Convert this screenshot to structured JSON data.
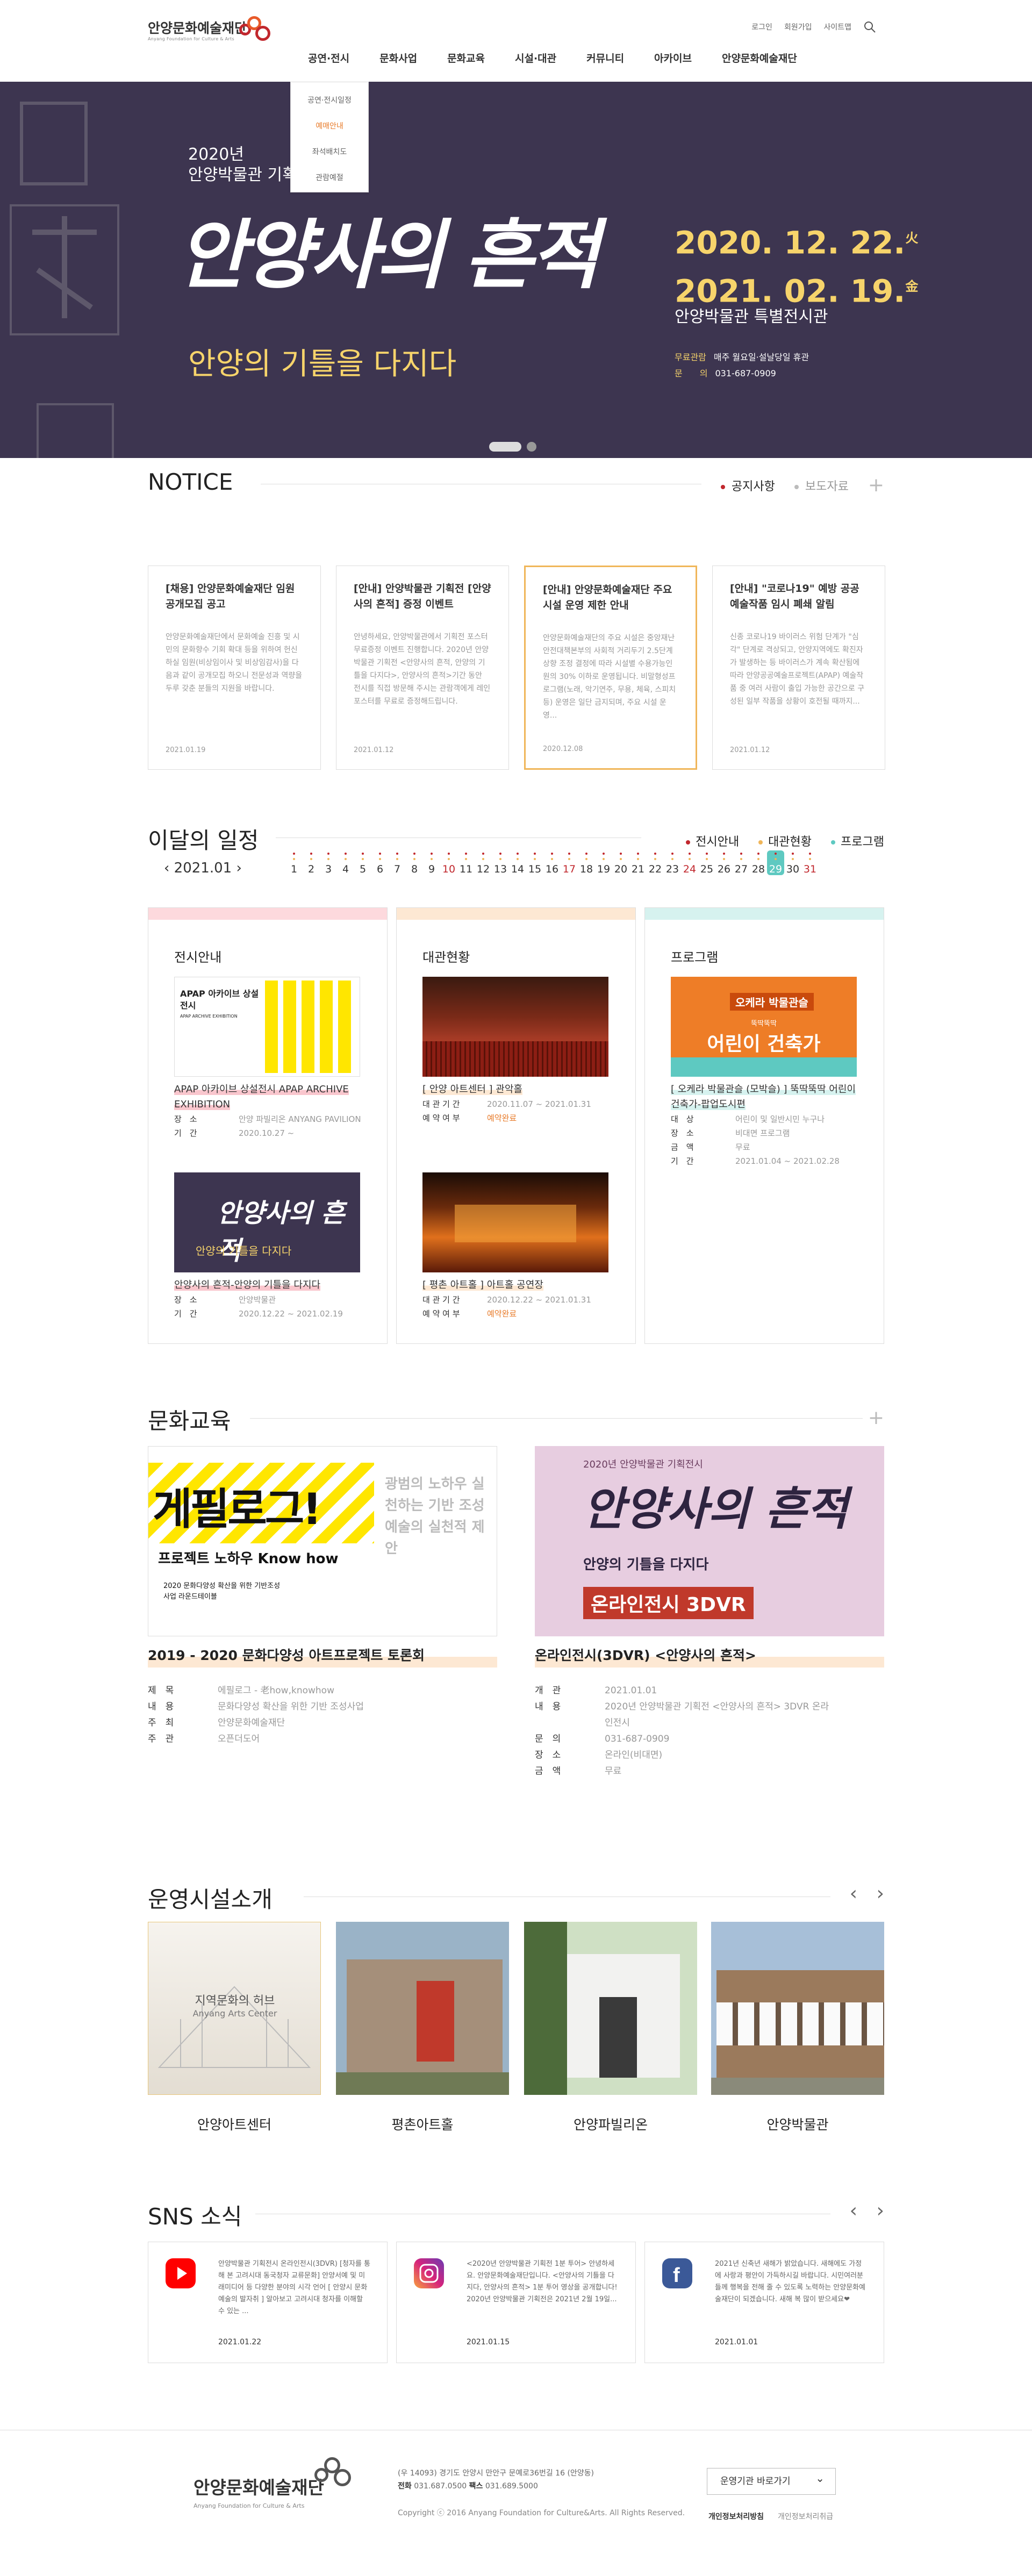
{
  "header": {
    "logo": "안양문화예술재단",
    "logo_sub": "Anyang Foundation for Culture & Arts",
    "util": [
      "로그인",
      "회원가입",
      "사이트맵"
    ],
    "gnb": [
      "공연·전시",
      "문화사업",
      "문화교육",
      "시설·대관",
      "커뮤니티",
      "아카이브",
      "안양문화예술재단"
    ],
    "submenu": [
      "공연·전시일정",
      "예매안내",
      "좌석배치도",
      "관람예절"
    ]
  },
  "visual": {
    "year": "2020년",
    "subtitle": "안양박물관 기획전시",
    "title": "안양사의 흔적",
    "slogan": "안양의 기틀을 다지다",
    "date1": "2020. 12. 22.",
    "day1": "火",
    "date2": "2021. 02. 19.",
    "day2": "金",
    "venue": "안양박물관 특별전시관",
    "info": [
      {
        "k": "무료관람",
        "v": "매주 월요일·설날당일 휴관"
      },
      {
        "k": "문　　의",
        "v": "031-687-0909"
      }
    ]
  },
  "notice": {
    "title": "NOTICE",
    "tabs": [
      "공지사항",
      "보도자료"
    ],
    "cards": [
      {
        "title": "[채용] 안양문화예술재단 임원 공개모집 공고",
        "desc": "안양문화예술재단에서 문화예술 진흥 및 시민의 문화향수 기회 확대 등을 위하여 헌신하실 임원(비상임이사 및 비상임감사)을 다음과 같이 공개모집 하오니 전문성과 역량을 두루 갖춘 분들의 지원을 바랍니다.",
        "date": "2021.01.19"
      },
      {
        "title": "[안내] 안양박물관 기획전 [안양사의 흔적] 증정 이벤트",
        "desc": "안녕하세요, 안양박물관에서 기획전 포스터 무료증정 이벤트 진행합니다. 2020년 안양박물관 기획전 <안양사의 흔적, 안양의 기틀을 다지다>, 안양사의 흔적>기간 동안 전시를 직접 방문해 주시는 관람객에게 레인포스터를 무료로 증정해드립니다.",
        "date": "2021.01.12"
      },
      {
        "title": "[안내] 안양문화예술재단 주요 시설 운영 제한 안내",
        "desc": "안양문화예술재단의 주요 시설은 중앙재난안전대책본부의 사회적 거리두기 2.5단계 상향 조정 결정에 따라 시설별 수용가능인원의 30% 이하로 운영됩니다. 비말형성프로그램(노래, 악기연주, 무용, 체육, 스피치 등) 운영은 일단 금지되며, 주요 시설 운영...",
        "date": "2020.12.08"
      },
      {
        "title": "[안내] \"코로나19\" 예방 공공예술작품 임시 폐쇄 알림",
        "desc": "신종 코로나19 바이러스 위험 단계가 \"심각\" 단계로 격상되고, 안양지역에도 확진자가 발생하는 등 바이러스가 계속 확산됨에 따라 안양공공예술프로젝트(APAP) 예술작품 중 여러 사람이 출입 가능한 공간으로 구성된 일부 작품을 상황이 호전될 때까지...",
        "date": "2021.01.12"
      }
    ]
  },
  "schedule": {
    "title": "이달의 일정",
    "month": "2021.01",
    "legend": [
      "전시안내",
      "대관현황",
      "프로그램"
    ],
    "days": [
      "1",
      "2",
      "3",
      "4",
      "5",
      "6",
      "7",
      "8",
      "9",
      "10",
      "11",
      "12",
      "13",
      "14",
      "15",
      "16",
      "17",
      "18",
      "19",
      "20",
      "21",
      "22",
      "23",
      "24",
      "25",
      "26",
      "27",
      "28",
      "29",
      "30",
      "31"
    ],
    "today": "29",
    "exhibit": {
      "title": "전시안내",
      "items": [
        {
          "name": "APAP 아카이브 상설전시 APAP ARCHIVE EXHIBITION",
          "img_title": "APAP 아카이브 상설전시",
          "img_sub": "APAP ARCHIVE EXHIBITION",
          "rows": [
            {
              "k": "장　소",
              "v": "안양 파빌리온 ANYANG PAVILION"
            },
            {
              "k": "기　간",
              "v": "2020.10.27 ~"
            }
          ]
        },
        {
          "name": "안양사의 흔적-안양의 기틀을 다지다",
          "img_title": "안양사의 흔적",
          "img_sub": "안양의 기틀을 다지다",
          "rows": [
            {
              "k": "장　소",
              "v": "안양박물관"
            },
            {
              "k": "기　간",
              "v": "2020.12.22 ~ 2021.02.19"
            }
          ]
        }
      ]
    },
    "rental": {
      "title": "대관현황",
      "items": [
        {
          "name": "[ 안양 아트센터 ] 관악홀",
          "rows": [
            {
              "k": "대 관 기 간",
              "v": "2020.11.07 ~ 2021.01.31"
            },
            {
              "k": "예 약 여 부",
              "v": "예약완료"
            }
          ]
        },
        {
          "name": "[ 평촌 아트홀 ] 아트홀 공연장",
          "rows": [
            {
              "k": "대 관 기 간",
              "v": "2020.12.22 ~ 2021.01.31"
            },
            {
              "k": "예 약 여 부",
              "v": "예약완료"
            }
          ]
        }
      ]
    },
    "program": {
      "title": "프로그램",
      "item": {
        "name": "[ 오케라 박물관슬 (모박슬) ] 뚝딱뚝딱 어린이건축가-팝업도시편",
        "img_top": "오케라 박물관슬",
        "img_main": "어린이 건축가",
        "img_small": "뚝딱뚝딱",
        "rows": [
          {
            "k": "대　상",
            "v": "어린이 및 일반시민 누구나"
          },
          {
            "k": "장　소",
            "v": "비대면 프로그램"
          },
          {
            "k": "금　액",
            "v": "무료"
          },
          {
            "k": "기　간",
            "v": "2021.01.04 ~ 2021.02.28"
          }
        ]
      }
    }
  },
  "edu": {
    "title": "문화교육",
    "items": [
      {
        "name": "2019 - 2020 문화다양성 아트프로젝트 토론회",
        "img_main": "게필로그!",
        "img_sub": "프로젝트 노하우 Know how",
        "img_side": "광범의 노하우 실천하는 기반 조성 예술의 실천적 제안",
        "img_note": "2020 문화다양성 확산을 위한 기반조성사업 라운드테이블",
        "rows": [
          {
            "k": "제　목",
            "v": "에필로그 - 老how,knowhow"
          },
          {
            "k": "내　용",
            "v": "문화다양성 확산을 위한 기반 조성사업"
          },
          {
            "k": "주　최",
            "v": "안양문화예술재단"
          },
          {
            "k": "주　관",
            "v": "오픈더도어"
          }
        ]
      },
      {
        "name": "온라인전시(3DVR) <안양사의 흔적>",
        "img_top": "2020년 안양박물관 기획전시",
        "img_main": "안양사의 흔적",
        "img_sub": "안양의 기틀을 다지다",
        "img_online": "온라인전시 3DVR",
        "rows": [
          {
            "k": "개　관",
            "v": "2021.01.01"
          },
          {
            "k": "내　용",
            "v": "2020년 안양박물관 기획전 <안양사의 흔적> 3DVR 온라인전시"
          },
          {
            "k": "문　의",
            "v": "031-687-0909"
          },
          {
            "k": "장　소",
            "v": "온라인(비대면)"
          },
          {
            "k": "금　액",
            "v": "무료"
          }
        ]
      }
    ]
  },
  "facility": {
    "title": "운영시설소개",
    "items": [
      {
        "name": "안양아트센터",
        "overlay": "지역문화의 허브",
        "overlay_sub": "Anyang Arts Center"
      },
      {
        "name": "평촌아트홀"
      },
      {
        "name": "안양파빌리온"
      },
      {
        "name": "안양박물관"
      }
    ]
  },
  "sns": {
    "title": "SNS 소식",
    "items": [
      {
        "icon": "youtube-icon",
        "color": "#ff0000",
        "text": "안양박물관 기획전시 온라인전시(3DVR) [청자를 통해 본 고려시대 동국청자 교류문화] 안양서예 및 미래미디어 등 다양한 분야의 시각 언어 [ 안양시 문화예술의 발자취 ] 알아보고 고려시대 청자를 이해할 수 있는 ...",
        "date": "2021.01.22"
      },
      {
        "icon": "instagram-icon",
        "color": "#d6247c",
        "text": "<2020년 안양박물관 기획전 1분 투어> 안녕하세요. 안양문화예술재단입니다. <안양사의 기틀을 다지다, 안양사의 흔적> 1분 투어 영상을 공개합니다! 2020년 안양박물관 기획전은 2021년 2월 19일...",
        "date": "2021.01.15"
      },
      {
        "icon": "facebook-icon",
        "color": "#3b5998",
        "text": "2021년 신축년 새해가 밝았습니다. 새해에도 가정에 사랑과 평안이 가득하시길 바랍니다. 시민여러분들께 행복을 전해 줄 수 있도록 노력하는 안양문화예술재단이 되겠습니다. 새해 복 많이 받으세요❤",
        "date": "2021.01.01"
      }
    ]
  },
  "footer": {
    "logo": "안양문화예술재단",
    "logo_sub": "Anyang Foundation for Culture & Arts",
    "addr": "(우 14093) 경기도 안양시 만안구 문예로36번길 16 (안양동)",
    "tel_label": "전화",
    "tel": "031.687.0500",
    "fax_label": "팩스",
    "fax": "031.689.5000",
    "copy": "Copyright ⓒ 2016 Anyang Foundation for Culture&Arts. All Rights Reserved.",
    "select": "운영기관 바로가기",
    "links": [
      "개인정보처리방침",
      "개인정보처리취급"
    ]
  }
}
